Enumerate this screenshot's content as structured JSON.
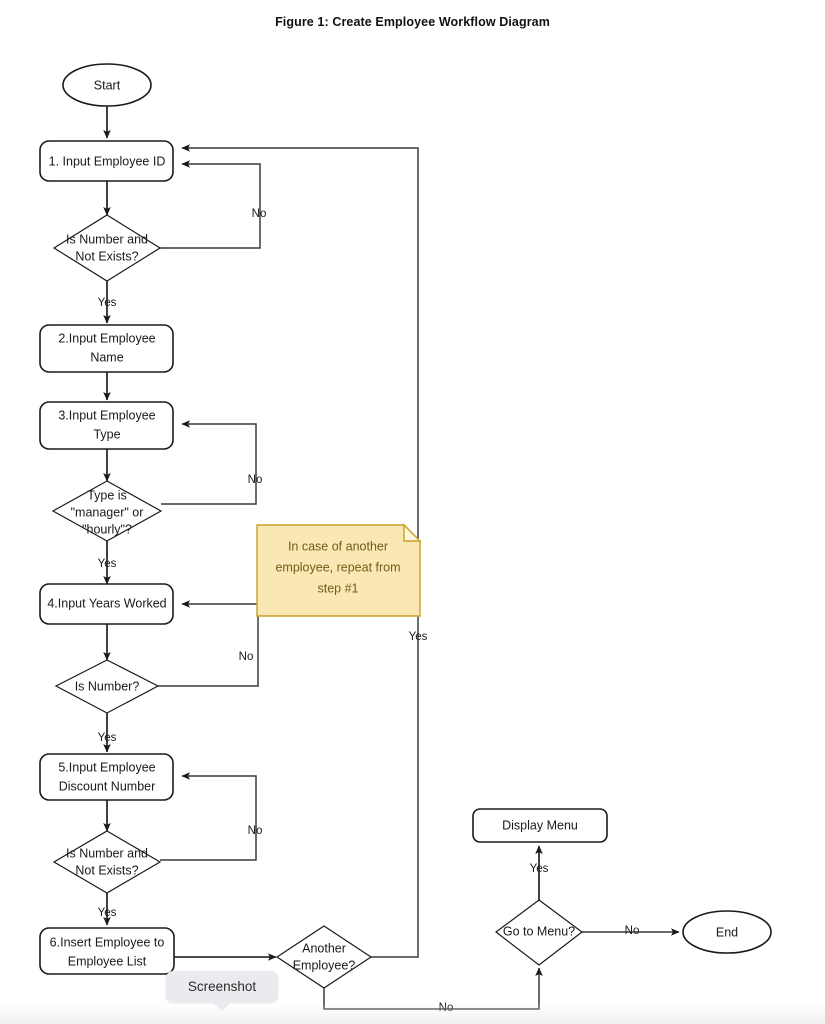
{
  "figure": {
    "title": "Figure 1: Create Employee Workflow Diagram"
  },
  "overlay": {
    "screenshot_tooltip": "Screenshot"
  },
  "colors": {
    "node_stroke": "#1a1a1a",
    "node_fill": "#ffffff",
    "edge_stroke": "#3b3b3b",
    "note_fill": "#f9e7b4",
    "note_stroke": "#c9a227",
    "note_text": "#6b6118",
    "tooltip_fill": "#eceaee",
    "page_background": "#ffffff"
  },
  "note": {
    "lines": [
      "In case of another",
      "employee, repeat from",
      "step #1"
    ]
  },
  "chart_data": {
    "type": "diagram",
    "diagram_kind": "flowchart",
    "title": "Figure 1: Create Employee Workflow Diagram",
    "orientation": "top-to-bottom",
    "nodes": [
      {
        "id": "start",
        "shape": "ellipse",
        "lines": [
          "Start"
        ]
      },
      {
        "id": "step1",
        "shape": "rounded-rect",
        "lines": [
          "1. Input Employee ID"
        ]
      },
      {
        "id": "dec1",
        "shape": "diamond",
        "lines": [
          "Is Number and",
          "Not Exists?"
        ]
      },
      {
        "id": "step2",
        "shape": "rounded-rect",
        "lines": [
          "2.Input Employee",
          "Name"
        ]
      },
      {
        "id": "step3",
        "shape": "rounded-rect",
        "lines": [
          "3.Input Employee",
          "Type"
        ]
      },
      {
        "id": "dec2",
        "shape": "diamond",
        "lines": [
          "Type is",
          "\"manager\" or",
          "\"hourly\"?"
        ]
      },
      {
        "id": "step4",
        "shape": "rounded-rect",
        "lines": [
          "4.Input Years Worked"
        ]
      },
      {
        "id": "dec3",
        "shape": "diamond",
        "lines": [
          "Is Number?"
        ]
      },
      {
        "id": "step5",
        "shape": "rounded-rect",
        "lines": [
          "5.Input Employee",
          "Discount Number"
        ]
      },
      {
        "id": "dec4",
        "shape": "diamond",
        "lines": [
          "Is Number and",
          "Not Exists?"
        ]
      },
      {
        "id": "step6",
        "shape": "rounded-rect",
        "lines": [
          "6.Insert Employee to",
          "Employee List"
        ]
      },
      {
        "id": "dec5",
        "shape": "diamond",
        "lines": [
          "Another",
          "Employee?"
        ]
      },
      {
        "id": "dec6",
        "shape": "diamond",
        "lines": [
          "Go to Menu?"
        ]
      },
      {
        "id": "display_menu",
        "shape": "rounded-rect",
        "lines": [
          "Display Menu"
        ]
      },
      {
        "id": "end",
        "shape": "ellipse",
        "lines": [
          "End"
        ]
      },
      {
        "id": "note1",
        "shape": "note",
        "lines": [
          "In case of another",
          "employee, repeat from",
          "step #1"
        ]
      }
    ],
    "edges": [
      {
        "from": "start",
        "to": "step1",
        "label": ""
      },
      {
        "from": "step1",
        "to": "dec1",
        "label": ""
      },
      {
        "from": "dec1",
        "to": "step1",
        "label": "No"
      },
      {
        "from": "dec1",
        "to": "step2",
        "label": "Yes"
      },
      {
        "from": "step2",
        "to": "step3",
        "label": ""
      },
      {
        "from": "step3",
        "to": "dec2",
        "label": ""
      },
      {
        "from": "dec2",
        "to": "step3",
        "label": "No"
      },
      {
        "from": "dec2",
        "to": "step4",
        "label": "Yes"
      },
      {
        "from": "step4",
        "to": "dec3",
        "label": ""
      },
      {
        "from": "dec3",
        "to": "step4",
        "label": "No"
      },
      {
        "from": "dec3",
        "to": "step5",
        "label": "Yes"
      },
      {
        "from": "step5",
        "to": "dec4",
        "label": ""
      },
      {
        "from": "dec4",
        "to": "step5",
        "label": "No"
      },
      {
        "from": "dec4",
        "to": "step6",
        "label": "Yes"
      },
      {
        "from": "step6",
        "to": "dec5",
        "label": ""
      },
      {
        "from": "dec5",
        "to": "step1",
        "label": "Yes"
      },
      {
        "from": "dec5",
        "to": "dec6",
        "label": "No"
      },
      {
        "from": "dec6",
        "to": "display_menu",
        "label": "Yes"
      },
      {
        "from": "dec6",
        "to": "end",
        "label": "No"
      }
    ],
    "edge_labels": [
      "No",
      "Yes",
      "No",
      "Yes",
      "No",
      "Yes",
      "No",
      "Yes",
      "Yes",
      "No",
      "Yes",
      "No"
    ]
  },
  "nodes": {
    "start": "Start",
    "step1": "1. Input Employee ID",
    "dec1_l1": "Is Number and",
    "dec1_l2": "Not Exists?",
    "step2_l1": "2.Input Employee",
    "step2_l2": "Name",
    "step3_l1": "3.Input Employee",
    "step3_l2": "Type",
    "dec2_l1": "Type is",
    "dec2_l2": "\"manager\" or",
    "dec2_l3": "\"hourly\"?",
    "step4": "4.Input Years Worked",
    "dec3": "Is Number?",
    "step5_l1": "5.Input Employee",
    "step5_l2": "Discount Number",
    "dec4_l1": "Is Number and",
    "dec4_l2": "Not Exists?",
    "step6_l1": "6.Insert Employee to",
    "step6_l2": "Employee List",
    "dec5_l1": "Another",
    "dec5_l2": "Employee?",
    "dec6": "Go to Menu?",
    "display_menu": "Display Menu",
    "end": "End",
    "note_l1": "In case of another",
    "note_l2": "employee, repeat from",
    "note_l3": "step #1"
  },
  "labels": {
    "dec1_no": "No",
    "dec1_yes": "Yes",
    "dec2_no": "No",
    "dec2_yes": "Yes",
    "dec3_no": "No",
    "dec3_yes": "Yes",
    "dec4_no": "No",
    "dec4_yes": "Yes",
    "dec5_yes": "Yes",
    "dec5_no": "No",
    "dec6_yes": "Yes",
    "dec6_no": "No"
  }
}
